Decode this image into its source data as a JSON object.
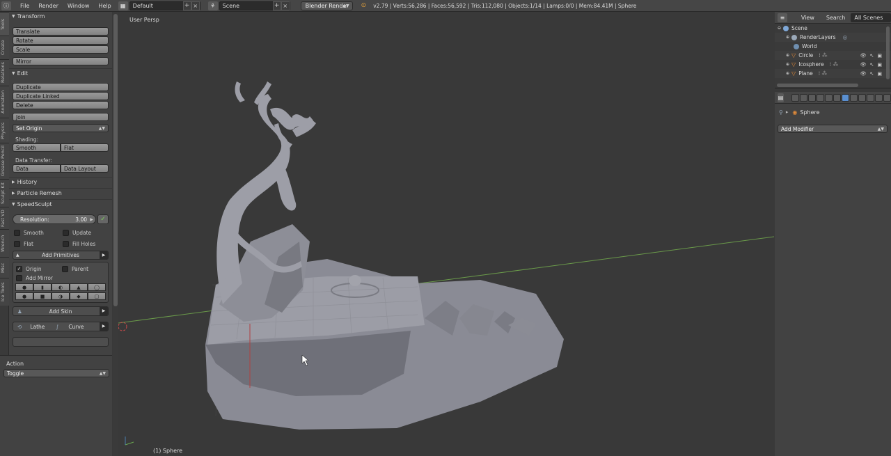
{
  "topbar": {
    "menus": [
      "File",
      "Render",
      "Window",
      "Help"
    ],
    "screen_layout": "Default",
    "scene": "Scene",
    "render_engine": "Blender Render",
    "stats": "v2.79 | Verts:56,286 | Faces:56,592 | Tris:112,080 | Objects:1/14 | Lamps:0/0 | Mem:84.41M | Sphere"
  },
  "tabs": [
    "Tools",
    "Create",
    "Relations",
    "Animation",
    "Physics",
    "Grease Pencil",
    "Sculpt Kit",
    "Fast VD",
    "Wrench",
    "Misc",
    "Ice Tools"
  ],
  "toolshelf": {
    "transform": {
      "title": "Transform",
      "buttons": [
        "Translate",
        "Rotate",
        "Scale",
        "Mirror"
      ]
    },
    "edit": {
      "title": "Edit",
      "buttons": [
        "Duplicate",
        "Duplicate Linked",
        "Delete",
        "Join"
      ],
      "set_origin": "Set Origin",
      "shading_label": "Shading:",
      "smooth": "Smooth",
      "flat": "Flat",
      "data_transfer_label": "Data Transfer:",
      "data": "Data",
      "data_layout": "Data Layout"
    },
    "history": "History",
    "particle_remesh": "Particle Remesh",
    "speedsculpt": {
      "title": "SpeedSculpt",
      "resolution_label": "Resolution:",
      "resolution_value": "3.00",
      "smooth": "Smooth",
      "update": "Update",
      "flat": "Flat",
      "fill_holes": "Fill Holes",
      "add_primitives": "Add Primitives",
      "origin": "Origin",
      "parent": "Parent",
      "add_mirror": "Add Mirror",
      "add_skin": "Add Skin",
      "lathe": "Lathe",
      "curve": "Curve"
    }
  },
  "operator": {
    "title": "Action",
    "value": "Toggle"
  },
  "viewport": {
    "label": "User Persp",
    "object": "(1) Sphere"
  },
  "outliner": {
    "header": {
      "view": "View",
      "search": "Search",
      "all_scenes": "All Scenes"
    },
    "rows": [
      {
        "label": "Scene",
        "icon": "scene-icon",
        "color": "#7fa8d8"
      },
      {
        "label": "RenderLayers",
        "icon": "renderlayers-icon",
        "color": "#9aa8b8"
      },
      {
        "label": "World",
        "icon": "world-icon",
        "color": "#6f8fb0"
      },
      {
        "label": "Circle",
        "icon": "object-icon",
        "color": "#e08a3a"
      },
      {
        "label": "Icosphere",
        "icon": "object-icon",
        "color": "#e08a3a"
      },
      {
        "label": "Plane",
        "icon": "object-icon",
        "color": "#e08a3a"
      }
    ]
  },
  "properties": {
    "object_name": "Sphere",
    "add_modifier": "Add Modifier"
  }
}
